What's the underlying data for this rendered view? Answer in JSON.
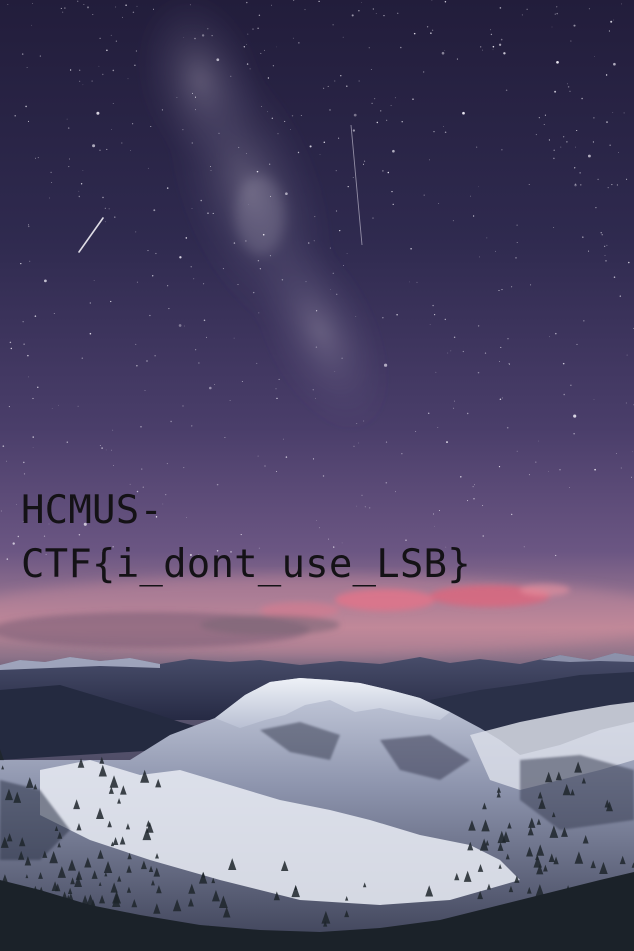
{
  "overlay": {
    "line1": "HCMUS-",
    "line2": "CTF{i_dont_use_LSB}"
  },
  "colors": {
    "sky_top": "#25203f",
    "sky_mid": "#4f4170",
    "sky_low": "#8b6b93",
    "horizon_glow": "#d58a98",
    "cloud_pink": "#e0708a",
    "mountain_far": "#2c3352",
    "snow": "#e6eaf2",
    "forest": "#1c2328",
    "text": "#141216"
  },
  "scene_description_icons": [
    "milky-way",
    "shooting-star",
    "star-field",
    "pink-clouds",
    "snowy-mountains",
    "pine-forest"
  ]
}
